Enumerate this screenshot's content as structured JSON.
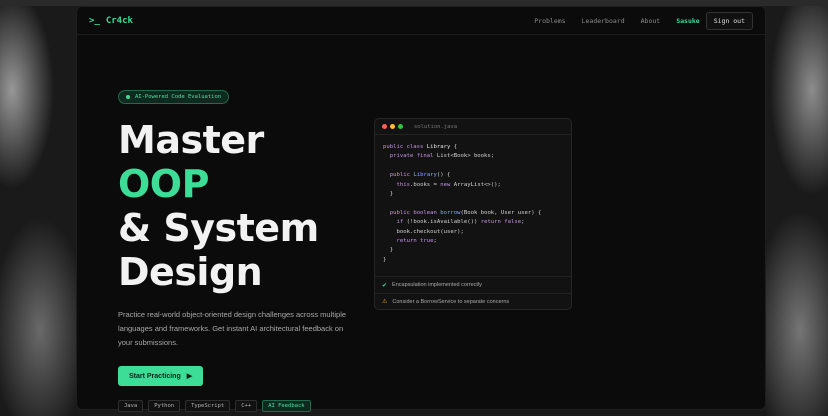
{
  "nav": {
    "brand_icon": ">_",
    "brand": "Cr4ck",
    "links": [
      "Problems",
      "Leaderboard",
      "About"
    ],
    "user": "Sasuke",
    "signout": "Sign out"
  },
  "hero": {
    "badge": "AI-Powered Code Evaluation",
    "headline_1": "Master ",
    "headline_accent": "OOP",
    "headline_2": "& System",
    "headline_3": "Design",
    "subtitle": "Practice real-world object-oriented design challenges across multiple languages and frameworks. Get instant AI architectural feedback on your submissions.",
    "cta": "Start Practicing",
    "tags": [
      "Java",
      "Python",
      "TypeScript",
      "C++"
    ],
    "tag_accent": "AI Feedback"
  },
  "editor": {
    "filename": "solution.java",
    "feedback_ok": "Encapsulation implemented correctly",
    "feedback_warn": "Consider a BorrowService to separate concerns"
  },
  "colors": {
    "accent": "#3ddc97",
    "background": "#0b0b0b"
  }
}
